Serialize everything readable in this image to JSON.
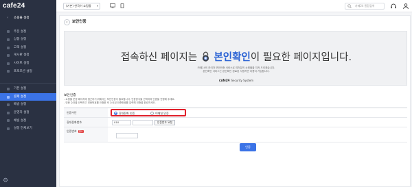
{
  "app": {
    "logo": "cafe24"
  },
  "sidebar": {
    "section_label": "쇼핑몰 설정",
    "items": [
      {
        "label": "주문 설정"
      },
      {
        "label": "상품 설정"
      },
      {
        "label": "고객 설정"
      },
      {
        "label": "게시판 설정"
      },
      {
        "label": "사이트 설정"
      },
      {
        "label": "프로모션 설정"
      }
    ],
    "items2": [
      {
        "label": "기본 설정"
      },
      {
        "label": "결제 설정",
        "active": true
      },
      {
        "label": "배송 설정"
      },
      {
        "label": "운영자 설정"
      },
      {
        "label": "채널 설정"
      },
      {
        "label": "설정 전체보기"
      }
    ]
  },
  "topbar": {
    "mall_select": "(기본) 한국어 쇼핑몰",
    "search_placeholder": "카페24 통합검색"
  },
  "page": {
    "title": "보안인증",
    "banner": {
      "headline_pre": "접속하신 페이지는",
      "headline_highlight": "본인확인",
      "headline_post": "이 필요한 페이지입니다.",
      "desc_line1": "카페24의 관리자 보안인증 서비스로 여러분의 쇼핑몰을 지켜 드리겠습니다.",
      "desc_line2": "본인확인 서비스는 본인확인 완료된 사용자만 이용이 가능합니다.",
      "brand_logo": "cafe24",
      "brand_text": "Security System"
    },
    "section_title": "보안인증",
    "notes": [
      "- 쇼핑몰 운영 페이지에 접근하기 위해서는 보안인증이 필요합니다. 인증방식을 선택하여 인증을 진행해 주세요.",
      "- 인증 수단을 선택하고 인증번호를 요청한 후 수신된 인증번호를 입력해 인증을 완료하세요."
    ],
    "form": {
      "method_label": "인증수단",
      "method_options": [
        "휴대전화 인증",
        "이메일 인증"
      ],
      "method_selected": 0,
      "phone_label": "휴대전화번호",
      "phone_prefix": "010",
      "send_button": "인증번호 요청",
      "code_label": "인증번호",
      "required_badge": "필수"
    },
    "submit_button": "인증"
  }
}
